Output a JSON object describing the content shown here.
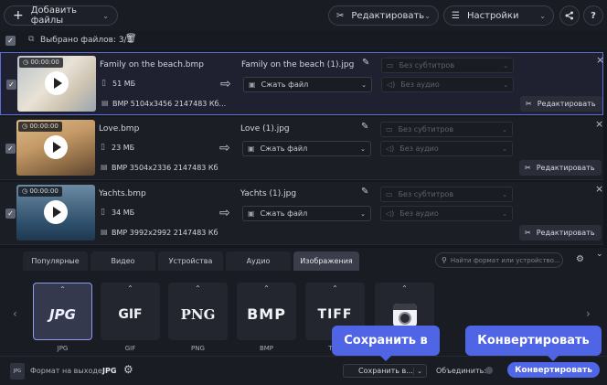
{
  "toolbar": {
    "add_files": "Добавить файлы",
    "edit": "Редактировать",
    "settings": "Настройки"
  },
  "selection": {
    "label": "Выбрано файлов: 3/3"
  },
  "files": [
    {
      "duration": "00:00:00",
      "name": "Family on the beach.bmp",
      "size": "51 МБ",
      "info": "BMP 5104x3456 2147483 Кб...",
      "output": "Family on the beach (1).jpg",
      "compress": "Сжать файл",
      "subtitles": "Без субтитров",
      "audio": "Без аудио",
      "edit": "Редактировать"
    },
    {
      "duration": "00:00:00",
      "name": "Love.bmp",
      "size": "23 МБ",
      "info": "BMP 3504x2336 2147483 Кб",
      "output": "Love (1).jpg",
      "compress": "Сжать файл",
      "subtitles": "Без субтитров",
      "audio": "Без аудио",
      "edit": "Редактировать"
    },
    {
      "duration": "00:00:00",
      "name": "Yachts.bmp",
      "size": "34 МБ",
      "info": "BMP 3992x2992 2147483 Кб",
      "output": "Yachts (1).jpg",
      "compress": "Сжать файл",
      "subtitles": "Без субтитров",
      "audio": "Без аудио",
      "edit": "Редактировать"
    }
  ],
  "tabs": [
    "Популярные",
    "Видео",
    "Устройства",
    "Аудио",
    "Изображения"
  ],
  "search": {
    "placeholder": "Найти формат или устройство..."
  },
  "formats": [
    {
      "logo": "JPG",
      "label": "JPG"
    },
    {
      "logo": "GIF",
      "label": "GIF"
    },
    {
      "logo": "PNG",
      "label": "PNG"
    },
    {
      "logo": "BMP",
      "label": "BMP"
    },
    {
      "logo": "TIFF",
      "label": "TIFF"
    },
    {
      "logo": "",
      "label": ""
    }
  ],
  "footer": {
    "badge": "JPG",
    "output_format_label": "Формат на выходе:",
    "output_format_value": "JPG",
    "save_to": "Сохранить в...",
    "merge": "Объединить:",
    "convert": "Конвертировать"
  },
  "tooltips": {
    "save": "Сохранить в",
    "convert": "Конвертировать"
  },
  "colors": {
    "accent": "#5064e6",
    "background": "#15171e"
  }
}
